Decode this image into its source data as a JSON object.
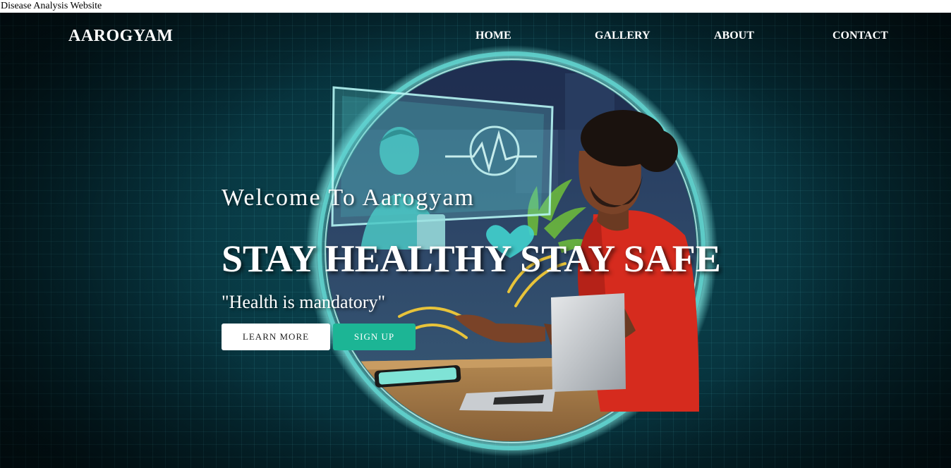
{
  "page": {
    "document_title": "Disease Analysis Website"
  },
  "navbar": {
    "brand": "AAROGYAM",
    "links": [
      {
        "label": "HOME"
      },
      {
        "label": "GALLERY"
      },
      {
        "label": "ABOUT"
      },
      {
        "label": "CONTACT"
      }
    ]
  },
  "hero": {
    "welcome": "Welcome To Aarogyam",
    "headline": "STAY HEALTHY STAY SAFE",
    "tagline": "\"Health is mandatory\"",
    "buttons": {
      "learn_more": "LEARN MORE",
      "sign_up": "SIGN UP"
    }
  },
  "colors": {
    "background_dark": "#06303a",
    "accent_teal": "#1cb595",
    "ring_glow": "#7fe6e0",
    "text": "#ffffff"
  }
}
